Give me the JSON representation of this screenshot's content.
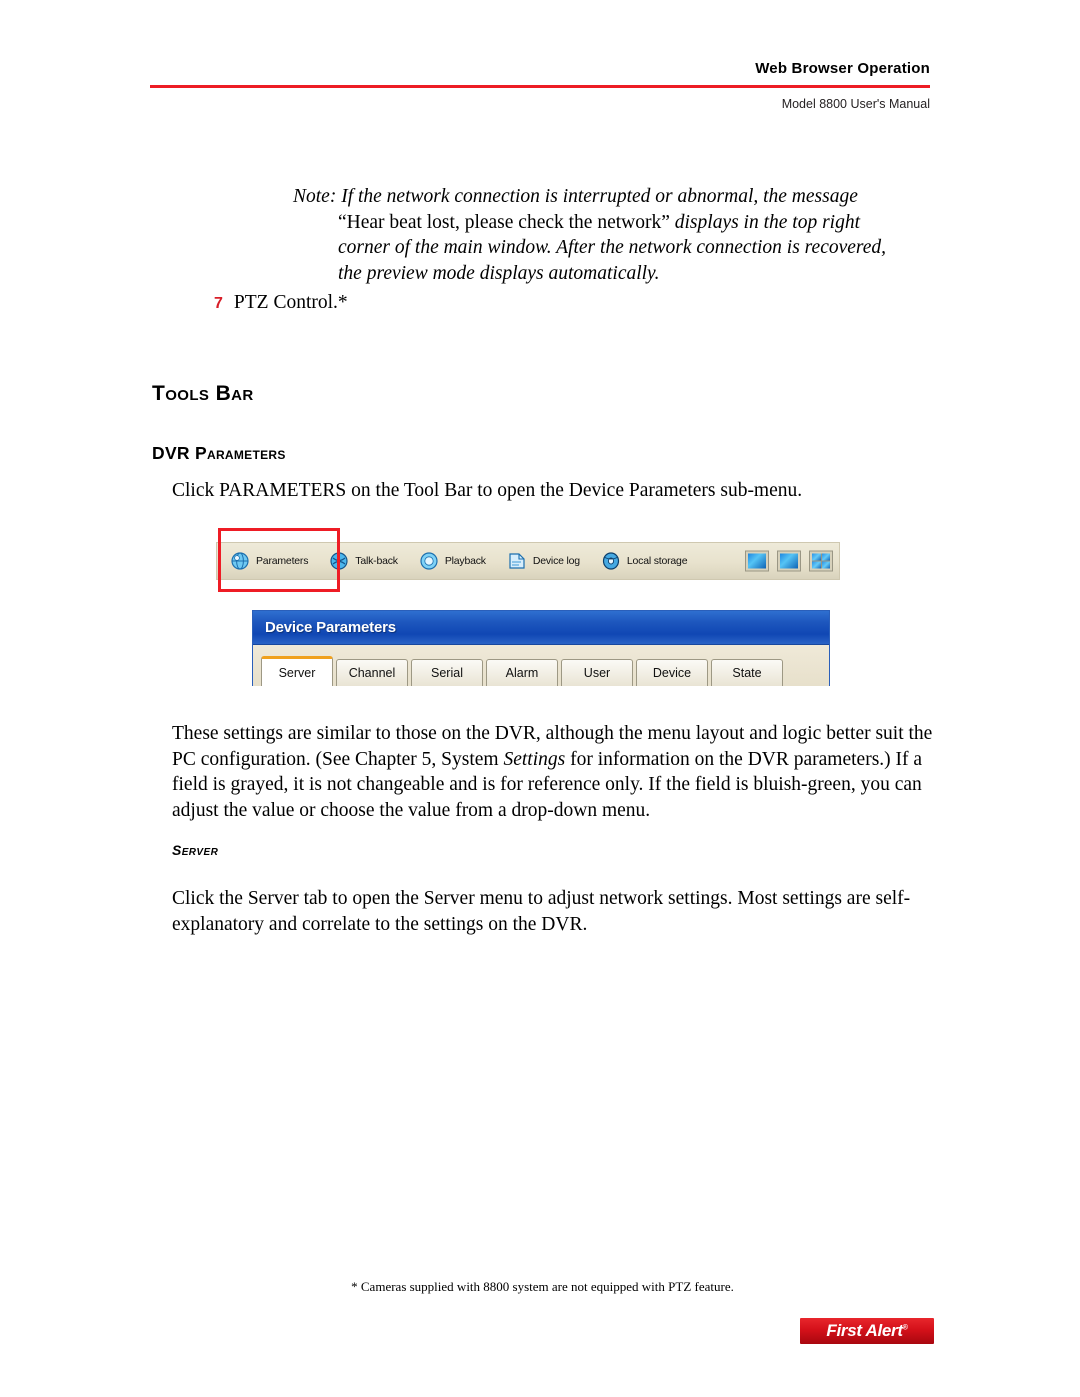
{
  "header": {
    "title": "Web Browser Operation",
    "subtitle": "Model 8800 User's Manual",
    "rule_color": "#ed1c24"
  },
  "note": {
    "label": "Note:",
    "line1_rest": " If the network connection is interrupted or abnormal, the message",
    "line2_quote": "“Hear beat lost, please check the network”",
    "line2_rest": " displays in the top right",
    "line3": "corner of the main window. After the network connection is recovered,",
    "line4": "the preview mode displays automatically."
  },
  "numbered_item": {
    "number": "7",
    "text": "PTZ Control.*",
    "number_color": "#d81e28"
  },
  "headings": {
    "tools_bar": "Tools Bar",
    "dvr_parameters": "DVR Parameters",
    "server": "Server"
  },
  "paragraphs": {
    "click_parameters": "Click PARAMETERS on the Tool Bar to open the Device Parameters sub-menu.",
    "these_settings_1": "These settings are similar to those on the DVR, although the menu layout and logic better suit the PC configuration. (See Chapter 5, System ",
    "these_settings_italic": "Settings",
    "these_settings_2": " for information on the DVR parameters.) If a field is grayed, it is not changeable and is for reference only. If the field is bluish-green, you can adjust the value or choose the value from a drop-down menu.",
    "server_body": "Click the Server tab to open the Server menu to adjust network settings. Most settings are self-explanatory and correlate to the settings on the DVR."
  },
  "toolbar": {
    "highlighted_item": "Parameters",
    "highlight_color": "#ee1c25",
    "items": [
      {
        "label": "Parameters",
        "icon": "parameters-globe-icon"
      },
      {
        "label": "Talk-back",
        "icon": "talkback-globe-icon"
      },
      {
        "label": "Playback",
        "icon": "playback-globe-icon"
      },
      {
        "label": "Device log",
        "icon": "device-log-icon"
      },
      {
        "label": "Local storage",
        "icon": "local-storage-icon"
      }
    ],
    "view_buttons": [
      {
        "name": "single-view-button"
      },
      {
        "name": "full-view-button"
      },
      {
        "name": "quad-view-button"
      }
    ]
  },
  "dialog": {
    "title": "Device Parameters",
    "title_bar_color": "#1047b4",
    "active_tab": "Server",
    "active_tab_accent": "#f0a11e",
    "tabs": [
      {
        "label": "Server",
        "active": true
      },
      {
        "label": "Channel",
        "active": false
      },
      {
        "label": "Serial",
        "active": false
      },
      {
        "label": "Alarm",
        "active": false
      },
      {
        "label": "User",
        "active": false
      },
      {
        "label": "Device",
        "active": false
      },
      {
        "label": "State",
        "active": false
      }
    ]
  },
  "footer": {
    "footnote": "* Cameras supplied with 8800 system are not equipped with PTZ feature.",
    "brand": "First Alert",
    "brand_mark": "®",
    "brand_color": "#d4111a"
  }
}
